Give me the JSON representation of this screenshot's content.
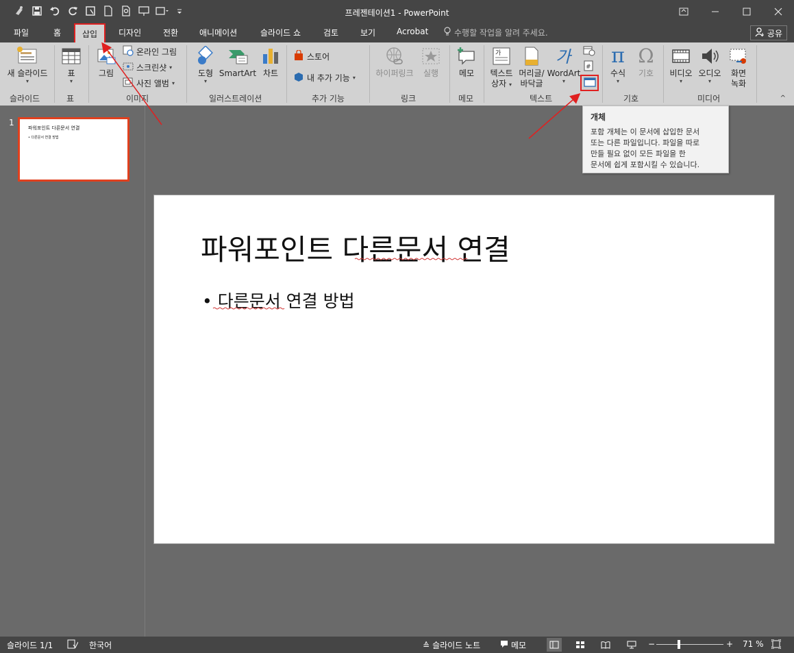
{
  "window": {
    "title": "프레젠테이션1 - PowerPoint"
  },
  "tabs": [
    {
      "label": "파일"
    },
    {
      "label": "홈"
    },
    {
      "label": "삽입"
    },
    {
      "label": "디자인"
    },
    {
      "label": "전환"
    },
    {
      "label": "애니메이션"
    },
    {
      "label": "슬라이드 쇼"
    },
    {
      "label": "검토"
    },
    {
      "label": "보기"
    },
    {
      "label": "Acrobat"
    }
  ],
  "tell_me": "수행할 작업을 알려 주세요.",
  "share": "공유",
  "ribbon": {
    "new_slide": "새 슬라이드",
    "table": "표",
    "picture": "그림",
    "online_picture": "온라인 그림",
    "screenshot": "스크린샷",
    "photo_album": "사진 앨범",
    "shapes": "도형",
    "smartart": "SmartArt",
    "chart": "차트",
    "store": "스토어",
    "my_addins": "내 추가 기능",
    "hyperlink": "하이퍼링크",
    "action": "실행",
    "comment": "메모",
    "textbox_1": "텍스트",
    "textbox_2": "상자",
    "header_footer_1": "머리글/",
    "header_footer_2": "바닥글",
    "wordart": "WordArt",
    "equation": "수식",
    "symbol": "기호",
    "video": "비디오",
    "audio": "오디오",
    "screen_rec_1": "화면",
    "screen_rec_2": "녹화",
    "groups": {
      "slides": "슬라이드",
      "tables": "표",
      "images": "이미지",
      "illustrations": "일러스트레이션",
      "addins": "추가 기능",
      "links": "링크",
      "comments": "메모",
      "text": "텍스트",
      "symbols": "기호",
      "media": "미디어"
    }
  },
  "tooltip": {
    "title": "개체",
    "body": "포함 개체는 이 문서에 삽입한 문서\n또는 다른 파일입니다. 파일을 따로\n만들 필요 없이 모든 파일을 한\n문서에 쉽게 포함시킬 수 있습니다."
  },
  "thumbnail": {
    "number": "1",
    "title": "파워포인트 다른문서 연결",
    "bullet": "• 다른문서 연결 방법"
  },
  "slide": {
    "title": "파워포인트 다른문서 연결",
    "bullet_marker": "•",
    "bullet_text": "다른문서 연결 방법"
  },
  "status": {
    "slide_counter": "슬라이드 1/1",
    "language": "한국어",
    "notes": "슬라이드 노트",
    "comments": "메모",
    "zoom": "71 %"
  },
  "colors": {
    "highlight": "#e02020",
    "titlebar": "#454545",
    "ribbon": "#d2d2d2"
  }
}
